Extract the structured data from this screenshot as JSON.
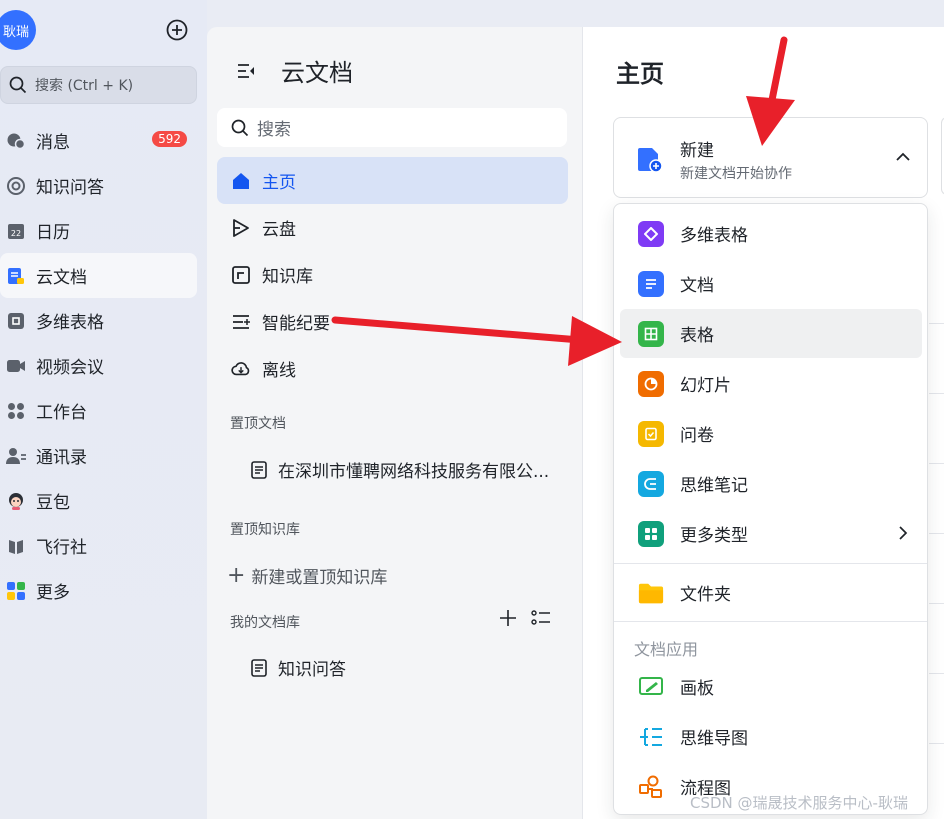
{
  "rail": {
    "avatar_text": "耿瑞",
    "search_placeholder": "搜索 (Ctrl + K)",
    "items": [
      {
        "label": "消息",
        "icon": "message-icon",
        "badge": "592"
      },
      {
        "label": "知识问答",
        "icon": "knowledge-qa-icon"
      },
      {
        "label": "日历",
        "icon": "calendar-icon",
        "icon_text": "22"
      },
      {
        "label": "云文档",
        "icon": "cloud-docs-icon",
        "active": true
      },
      {
        "label": "多维表格",
        "icon": "base-icon"
      },
      {
        "label": "视频会议",
        "icon": "video-meeting-icon"
      },
      {
        "label": "工作台",
        "icon": "workplace-icon"
      },
      {
        "label": "通讯录",
        "icon": "contacts-icon"
      },
      {
        "label": "豆包",
        "icon": "doubao-icon"
      },
      {
        "label": "飞行社",
        "icon": "feixingshe-icon"
      },
      {
        "label": "更多",
        "icon": "more-apps-icon"
      }
    ]
  },
  "docs": {
    "title": "云文档",
    "search_placeholder": "搜索",
    "nav": [
      {
        "label": "主页",
        "icon": "home-icon",
        "active": true
      },
      {
        "label": "云盘",
        "icon": "drive-icon"
      },
      {
        "label": "知识库",
        "icon": "wiki-icon"
      },
      {
        "label": "智能纪要",
        "icon": "smart-minutes-icon"
      },
      {
        "label": "离线",
        "icon": "offline-icon"
      }
    ],
    "pinned_docs_label": "置顶文档",
    "pinned_doc": "在深圳市懂聘网络科技服务有限公...",
    "pinned_kb_label": "置顶知识库",
    "new_kb_label": "新建或置顶知识库",
    "my_lib_label": "我的文档库",
    "my_lib_doc": "知识问答"
  },
  "main": {
    "title": "主页",
    "new_card": {
      "title": "新建",
      "subtitle": "新建文档开始协作"
    },
    "menu": {
      "items": [
        {
          "label": "多维表格",
          "icon": "base-icon",
          "color": "#7f3bf5"
        },
        {
          "label": "文档",
          "icon": "doc-icon",
          "color": "#3370ff"
        },
        {
          "label": "表格",
          "icon": "sheet-icon",
          "color": "#34b54a",
          "hover": true
        },
        {
          "label": "幻灯片",
          "icon": "slides-icon",
          "color": "#f06c00"
        },
        {
          "label": "问卷",
          "icon": "survey-icon",
          "color": "#f5b800"
        },
        {
          "label": "思维笔记",
          "icon": "mindnote-icon",
          "color": "#14a8e0"
        },
        {
          "label": "更多类型",
          "icon": "more-types-icon",
          "color": "#10a07c"
        }
      ],
      "folder_label": "文件夹",
      "apps_section": "文档应用",
      "apps": [
        {
          "label": "画板",
          "icon": "whiteboard-icon",
          "color": "#34b54a"
        },
        {
          "label": "思维导图",
          "icon": "mindmap-icon",
          "color": "#14a8e0"
        },
        {
          "label": "流程图",
          "icon": "flowchart-icon",
          "color": "#f06c00"
        }
      ]
    }
  },
  "watermark": "CSDN @瑞晟技术服务中心-耿瑞",
  "colors": {
    "accent": "#3370ff",
    "annotation": "#e8202a",
    "badge": "#f54a45"
  }
}
